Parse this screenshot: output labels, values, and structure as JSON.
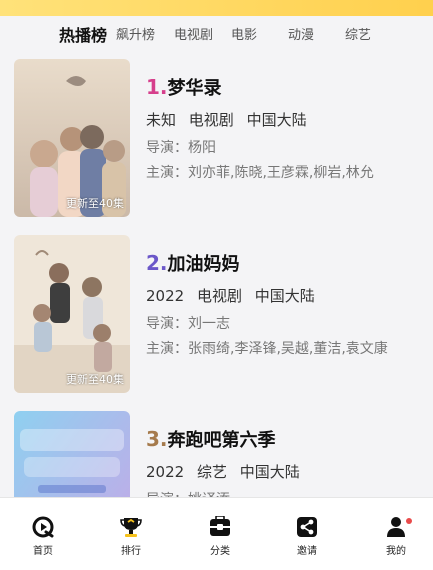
{
  "tabs": [
    "热播榜",
    "飙升榜",
    "电视剧",
    "电影",
    "动漫",
    "综艺"
  ],
  "active_tab": 0,
  "items": [
    {
      "rank": "1.",
      "rank_color": "#d63f8c",
      "title": "梦华录",
      "year": "未知",
      "category": "电视剧",
      "region": "中国大陆",
      "director": "导演：杨阳",
      "cast": "主演：刘亦菲,陈晓,王彦霖,柳岩,林允",
      "badge": "更新至40集"
    },
    {
      "rank": "2.",
      "rank_color": "#6b57c9",
      "title": "加油妈妈",
      "year": "2022",
      "category": "电视剧",
      "region": "中国大陆",
      "director": "导演：刘一志",
      "cast": "主演：张雨绮,李泽锋,吴越,董洁,袁文康",
      "badge": "更新至40集"
    },
    {
      "rank": "3.",
      "rank_color": "#a57a4c",
      "title": "奔跑吧第六季",
      "year": "2022",
      "category": "综艺",
      "region": "中国大陆",
      "director": "导演：姚译添",
      "cast": "",
      "badge": ""
    }
  ],
  "nav": [
    {
      "label": "首页",
      "icon": "home-icon"
    },
    {
      "label": "排行",
      "icon": "trophy-icon"
    },
    {
      "label": "分类",
      "icon": "category-icon"
    },
    {
      "label": "邀请",
      "icon": "share-icon"
    },
    {
      "label": "我的",
      "icon": "profile-icon"
    }
  ]
}
